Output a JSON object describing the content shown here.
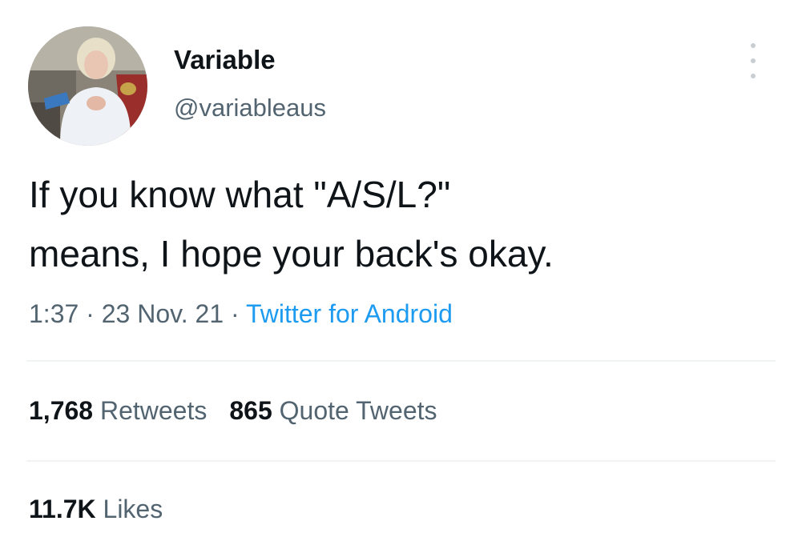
{
  "user": {
    "display_name": "Variable",
    "handle": "@variableaus"
  },
  "tweet": {
    "text_lines": [
      "If you know what \"A/S/L?\"",
      "means, I hope your back's okay."
    ],
    "time": "1:37",
    "separator": " · ",
    "date": "23 Nov. 21",
    "source": "Twitter for Android"
  },
  "stats": {
    "retweets_count": "1,768",
    "retweets_label": " Retweets",
    "quotes_count": "865",
    "quotes_label": " Quote Tweets",
    "likes_count": "11.7K",
    "likes_label": " Likes"
  },
  "icons": {
    "more": "more-vertical-icon"
  },
  "colors": {
    "text": "#0f1419",
    "secondary": "#536471",
    "link": "#1d9bf0",
    "divider": "#eff3f4"
  }
}
